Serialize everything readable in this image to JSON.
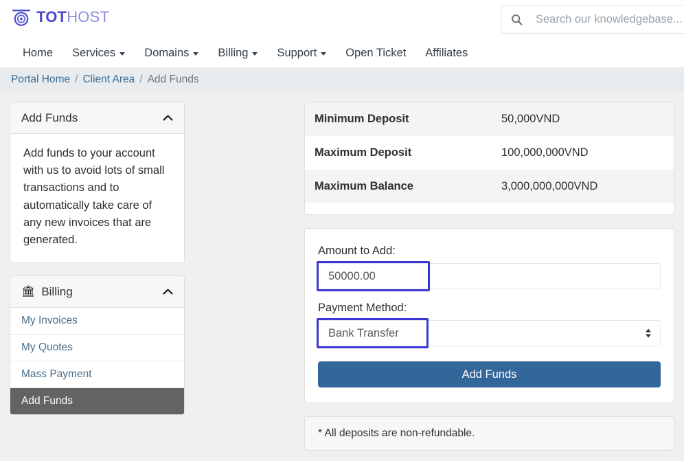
{
  "header": {
    "logo": {
      "icon": "tothost-eye-logo",
      "text_bold": "TOT",
      "text_light": "HOST"
    },
    "search": {
      "icon": "search-icon",
      "placeholder": "Search our knowledgebase...",
      "value": ""
    }
  },
  "nav": {
    "items": [
      {
        "label": "Home",
        "has_caret": false
      },
      {
        "label": "Services",
        "has_caret": true
      },
      {
        "label": "Domains",
        "has_caret": true
      },
      {
        "label": "Billing",
        "has_caret": true
      },
      {
        "label": "Support",
        "has_caret": true
      },
      {
        "label": "Open Ticket",
        "has_caret": false
      },
      {
        "label": "Affiliates",
        "has_caret": false
      }
    ]
  },
  "breadcrumb": {
    "items": [
      {
        "label": "Portal Home",
        "current": false
      },
      {
        "label": "Client Area",
        "current": false
      },
      {
        "label": "Add Funds",
        "current": true
      }
    ],
    "separator": "/"
  },
  "sidebar": {
    "info_panel": {
      "title": "Add Funds",
      "collapse_icon": "chevron-up-icon",
      "body": "Add funds to your account with us to avoid lots of small transactions and to automatically take care of any new invoices that are generated."
    },
    "billing_panel": {
      "title": "Billing",
      "icon": "bank-icon",
      "icon_glyph": "🏛",
      "collapse_icon": "chevron-up-icon",
      "items": [
        {
          "label": "My Invoices",
          "active": false
        },
        {
          "label": "My Quotes",
          "active": false
        },
        {
          "label": "Mass Payment",
          "active": false
        },
        {
          "label": "Add Funds",
          "active": true
        }
      ]
    }
  },
  "main": {
    "limits": [
      {
        "label": "Minimum Deposit",
        "value": "50,000VND"
      },
      {
        "label": "Maximum Deposit",
        "value": "100,000,000VND"
      },
      {
        "label": "Maximum Balance",
        "value": "3,000,000,000VND"
      }
    ],
    "form": {
      "amount_label": "Amount to Add:",
      "amount_value": "50000.00",
      "amount_placeholder": "",
      "method_label": "Payment Method:",
      "method_value": "Bank Transfer",
      "method_options": [
        "Bank Transfer"
      ],
      "method_arrow_icon": "chevron-up-down-icon",
      "submit_label": "Add Funds"
    },
    "note": "* All deposits are non-refundable."
  },
  "colors": {
    "brand_dark": "#4a4ad1",
    "brand_light": "#8b8bdd",
    "button_blue": "#336699",
    "highlight_blue": "#3b36d6",
    "active_item": "#636363",
    "breadcrumb_bg": "#e9ecef",
    "page_bg": "#f0f0f0"
  }
}
